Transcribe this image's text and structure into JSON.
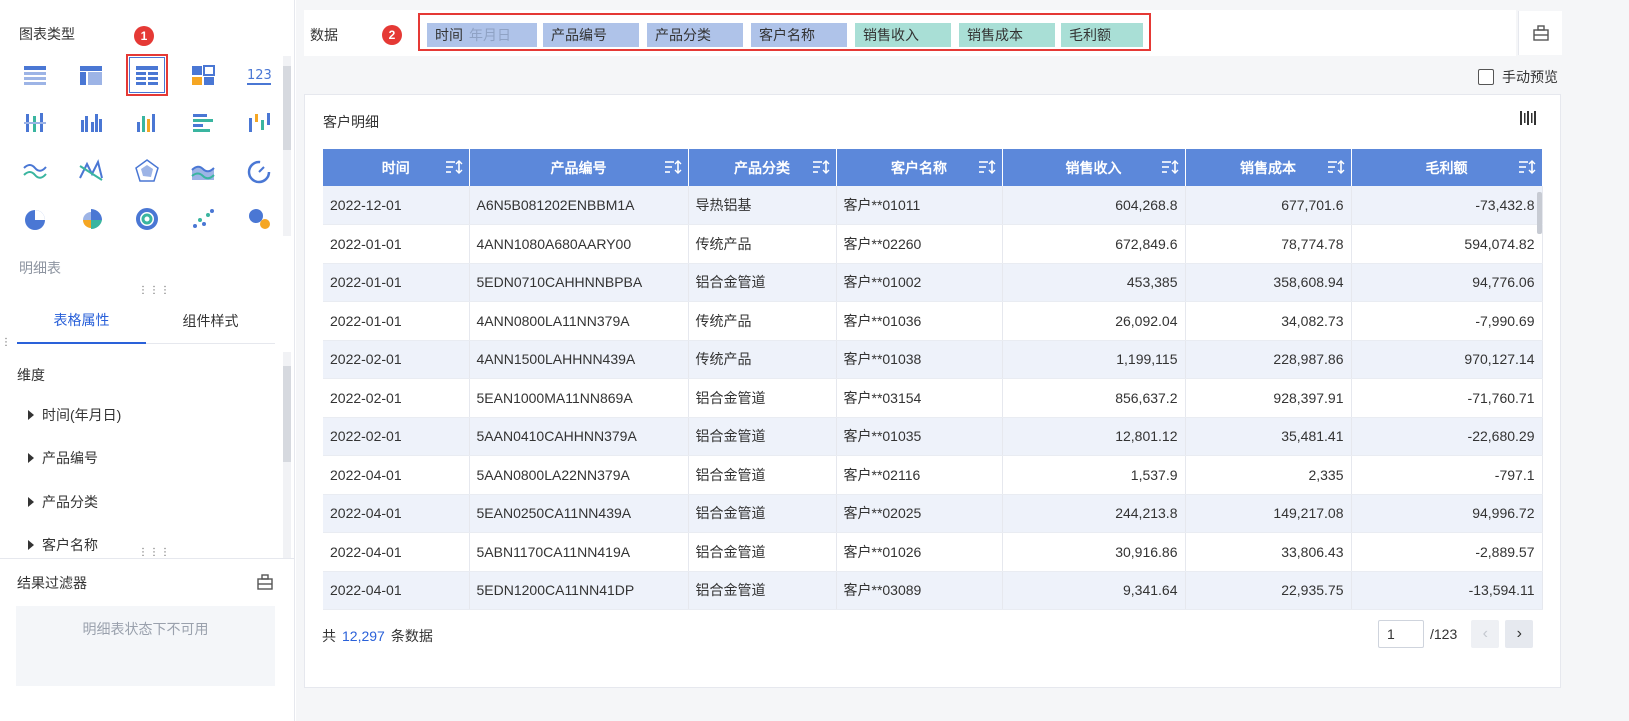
{
  "left_panel": {
    "chart_type_title": "图表类型",
    "selected_type_name": "明细表",
    "tabs": [
      {
        "label": "表格属性",
        "active": true
      },
      {
        "label": "组件样式",
        "active": false
      }
    ],
    "dimension_title": "维度",
    "dimensions": [
      "时间(年月日)",
      "产品编号",
      "产品分类",
      "客户名称"
    ],
    "filter_title": "结果过滤器",
    "filter_disabled_text": "明细表状态下不可用",
    "badge_1": "1"
  },
  "data_bar": {
    "label": "数据",
    "badge_2": "2",
    "fields": [
      {
        "label": "时间",
        "sub": "年月日",
        "kind": "dimension"
      },
      {
        "label": "产品编号",
        "kind": "dimension"
      },
      {
        "label": "产品分类",
        "kind": "dimension"
      },
      {
        "label": "客户名称",
        "kind": "dimension"
      },
      {
        "label": "销售收入",
        "kind": "measure"
      },
      {
        "label": "销售成本",
        "kind": "measure"
      },
      {
        "label": "毛利额",
        "kind": "measure"
      }
    ]
  },
  "preview": {
    "label": "手动预览",
    "checked": false
  },
  "table": {
    "title": "客户明细",
    "columns": [
      "时间",
      "产品编号",
      "产品分类",
      "客户名称",
      "销售收入",
      "销售成本",
      "毛利额"
    ],
    "rows": [
      [
        "2022-12-01",
        "A6N5B081202ENBBM1A",
        "导热铝基",
        "客户**01011",
        "604,268.8",
        "677,701.6",
        "-73,432.8"
      ],
      [
        "2022-01-01",
        "4ANN1080A680AARY00",
        "传统产品",
        "客户**02260",
        "672,849.6",
        "78,774.78",
        "594,074.82"
      ],
      [
        "2022-01-01",
        "5EDN0710CAHHNNBPBA",
        "铝合金管道",
        "客户**01002",
        "453,385",
        "358,608.94",
        "94,776.06"
      ],
      [
        "2022-01-01",
        "4ANN0800LA11NN379A",
        "传统产品",
        "客户**01036",
        "26,092.04",
        "34,082.73",
        "-7,990.69"
      ],
      [
        "2022-02-01",
        "4ANN1500LAHHNN439A",
        "传统产品",
        "客户**01038",
        "1,199,115",
        "228,987.86",
        "970,127.14"
      ],
      [
        "2022-02-01",
        "5EAN1000MA11NN869A",
        "铝合金管道",
        "客户**03154",
        "856,637.2",
        "928,397.91",
        "-71,760.71"
      ],
      [
        "2022-02-01",
        "5AAN0410CAHHNN379A",
        "铝合金管道",
        "客户**01035",
        "12,801.12",
        "35,481.41",
        "-22,680.29"
      ],
      [
        "2022-04-01",
        "5AAN0800LA22NN379A",
        "铝合金管道",
        "客户**02116",
        "1,537.9",
        "2,335",
        "-797.1"
      ],
      [
        "2022-04-01",
        "5EAN0250CA11NN439A",
        "铝合金管道",
        "客户**02025",
        "244,213.8",
        "149,217.08",
        "94,996.72"
      ],
      [
        "2022-04-01",
        "5ABN1170CA11NN419A",
        "铝合金管道",
        "客户**01026",
        "30,916.86",
        "33,806.43",
        "-2,889.57"
      ],
      [
        "2022-04-01",
        "5EDN1200CA11NN41DP",
        "铝合金管道",
        "客户**03089",
        "9,341.64",
        "22,935.75",
        "-13,594.11"
      ]
    ]
  },
  "footer": {
    "total_prefix": "共",
    "total_count": "12,297",
    "total_suffix": "条数据",
    "page_value": "1",
    "page_total": "/123"
  },
  "colors": {
    "header_blue": "#5c88da",
    "highlight_red": "#e53935",
    "dim_pill": "#afc3e9",
    "measure_pill": "#a9dfd6",
    "link_blue": "#2a61d9"
  }
}
